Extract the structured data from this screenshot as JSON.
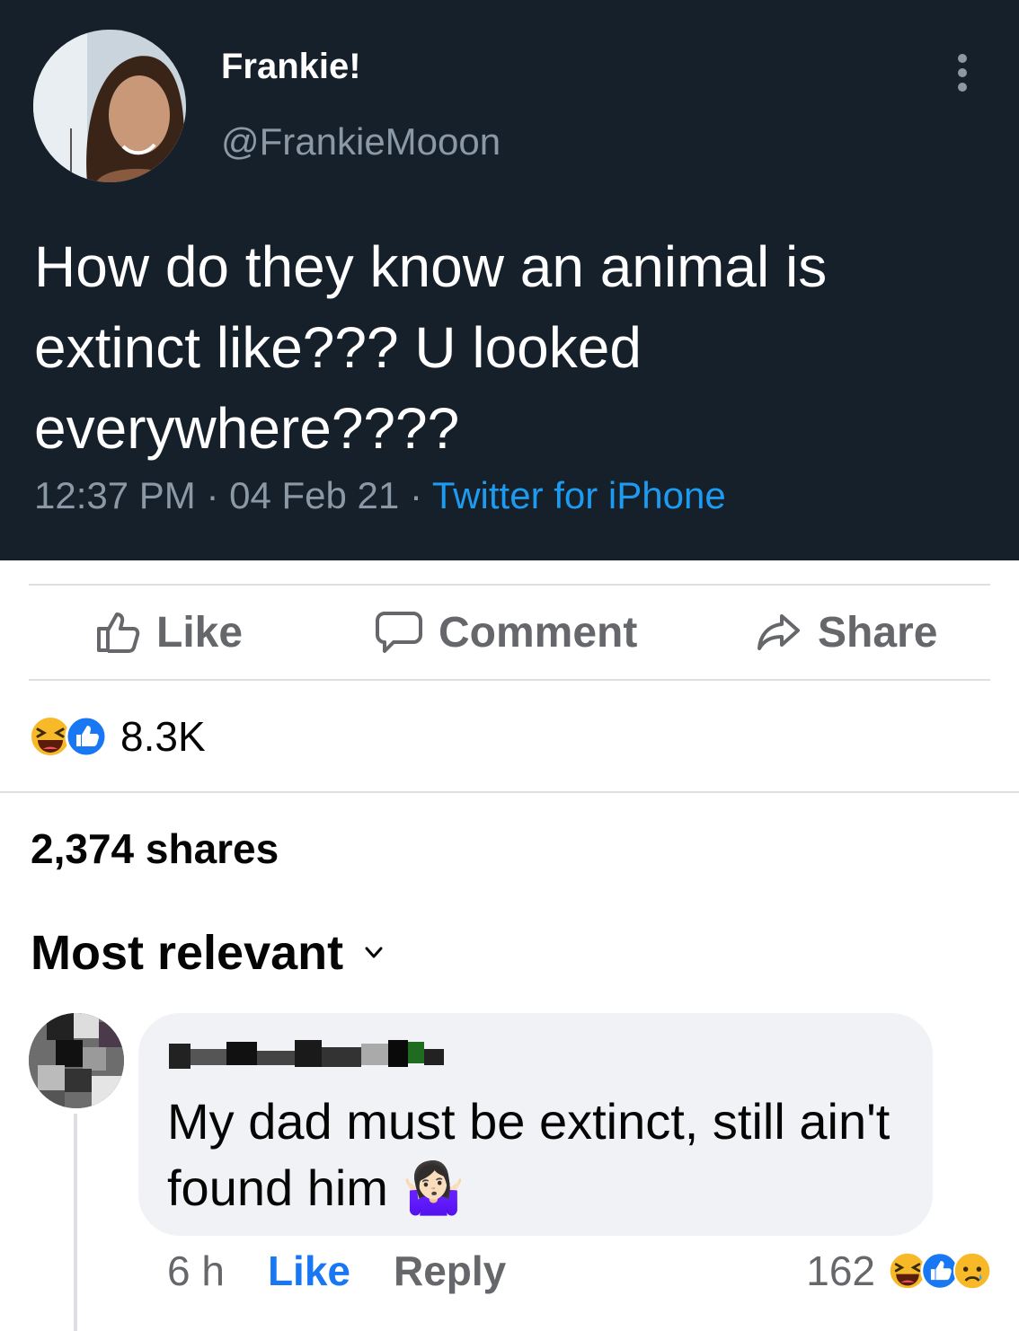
{
  "tweet": {
    "display_name": "Frankie!",
    "handle": "@FrankieMooon",
    "text": "How do they know an animal is extinct like??? U looked everywhere????",
    "time": "12:37 PM",
    "date": "04 Feb 21",
    "separator": "·",
    "source": "Twitter for iPhone",
    "colors": {
      "background": "#15202b",
      "muted": "#8b98a5",
      "link": "#1d9bf0"
    }
  },
  "post_actions": {
    "like_label": "Like",
    "comment_label": "Comment",
    "share_label": "Share"
  },
  "reactions": {
    "icons": [
      "haha-reaction-icon",
      "like-reaction-icon"
    ],
    "count": "8.3K"
  },
  "shares_text": "2,374 shares",
  "sort": {
    "label": "Most relevant",
    "icon": "chevron-down-icon"
  },
  "comment": {
    "text": "My dad must be extinct, still ain't found him",
    "emoji": "🤷🏻‍♀️",
    "time": "6 h",
    "like_label": "Like",
    "reply_label": "Reply",
    "reaction_count": "162",
    "reaction_icons": [
      "haha-reaction-icon",
      "like-reaction-icon",
      "sad-reaction-icon"
    ]
  },
  "accent": "#1877f2"
}
